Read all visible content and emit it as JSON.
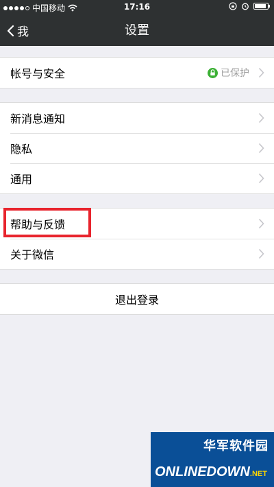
{
  "status_bar": {
    "carrier": "中国移动",
    "time": "17:16",
    "battery_level": 0.9,
    "icons": [
      "signal-icon",
      "wifi-icon",
      "lock-rotation-icon",
      "alarm-icon",
      "battery-icon"
    ]
  },
  "nav": {
    "back_label": "我",
    "title": "设置"
  },
  "account": {
    "label": "帐号与安全",
    "status": "已保护"
  },
  "group2": {
    "items": [
      "新消息通知",
      "隐私",
      "通用"
    ]
  },
  "group3": {
    "items": [
      "帮助与反馈",
      "关于微信"
    ]
  },
  "logout": {
    "label": "退出登录"
  },
  "watermark": {
    "cn": "华军软件园",
    "en": "ONLINEDOWN",
    "suffix": ".NET"
  },
  "colors": {
    "nav_bg": "#2e3132",
    "page_bg": "#efeff4",
    "highlight": "#e8242d",
    "protect_green": "#3cb035"
  }
}
